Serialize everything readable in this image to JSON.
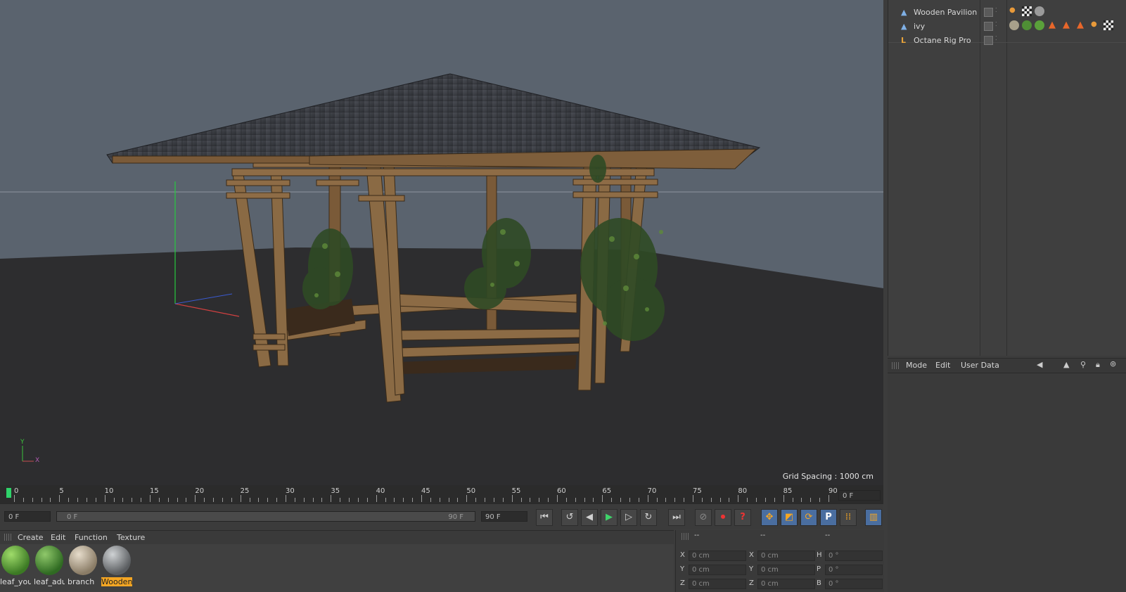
{
  "viewport": {
    "grid_spacing": "Grid Spacing : 1000 cm",
    "axis_y": "Y",
    "axis_x": "X"
  },
  "object_manager": {
    "objects": [
      {
        "name": "Wooden Pavilion"
      },
      {
        "name": "ivy"
      },
      {
        "name": "Octane Rig Pro"
      }
    ]
  },
  "attribute_manager": {
    "menu": [
      "Mode",
      "Edit",
      "User Data"
    ]
  },
  "timeline": {
    "ticks": [
      "0",
      "5",
      "10",
      "15",
      "20",
      "25",
      "30",
      "35",
      "40",
      "45",
      "50",
      "55",
      "60",
      "65",
      "70",
      "75",
      "80",
      "85",
      "90"
    ],
    "current_frame": "0 F",
    "start_frame": "0 F",
    "range_start": "0 F",
    "range_end": "90 F",
    "end_frame": "90 F"
  },
  "material_manager": {
    "menu": [
      "Create",
      "Edit",
      "Function",
      "Texture"
    ],
    "materials": [
      {
        "label": "leaf_you",
        "color": "#5aa03a"
      },
      {
        "label": "leaf_adu",
        "color": "#4f8f35"
      },
      {
        "label": "branch",
        "color": "#b9a88c"
      },
      {
        "label": "Wooden",
        "color": "#8a8d90",
        "selected": true
      }
    ]
  },
  "coordinates": {
    "header": [
      "--",
      "--",
      "--"
    ],
    "rows": [
      {
        "l1": "X",
        "v1": "0 cm",
        "l2": "X",
        "v2": "0 cm",
        "l3": "H",
        "v3": "0 °"
      },
      {
        "l1": "Y",
        "v1": "0 cm",
        "l2": "Y",
        "v2": "0 cm",
        "l3": "P",
        "v3": "0 °"
      },
      {
        "l1": "Z",
        "v1": "0 cm",
        "l2": "Z",
        "v2": "0 cm",
        "l3": "B",
        "v3": "0 °"
      }
    ]
  },
  "colors": {
    "sky": "#5b6470",
    "ground": "#2e2e30",
    "wood": "#8a6a44",
    "roof": "#3b3d42",
    "accent_orange": "#f5a623",
    "accent_blue": "#4a7fc1"
  }
}
